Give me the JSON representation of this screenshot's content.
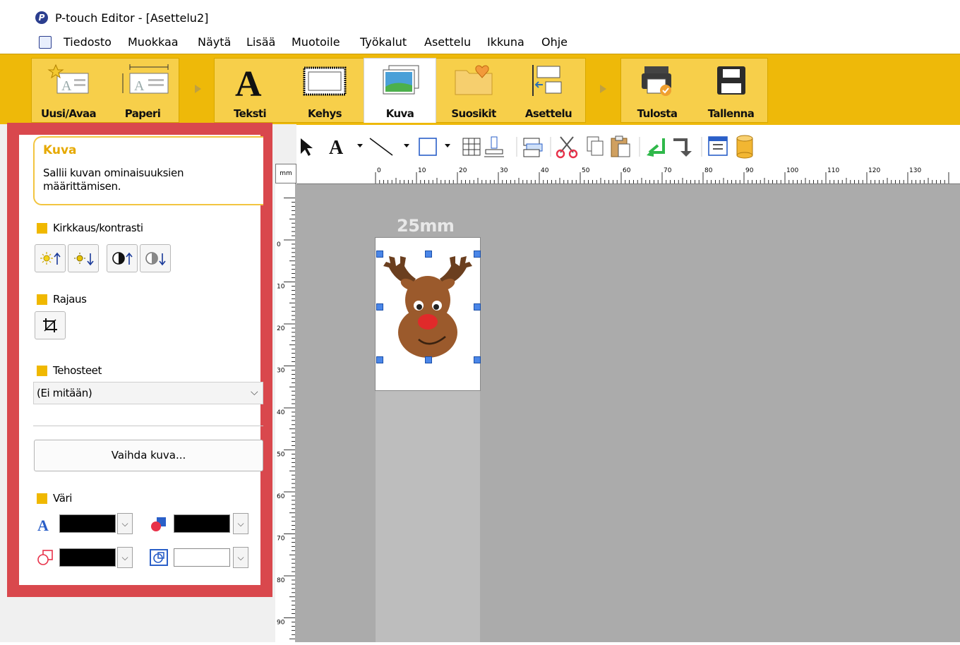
{
  "window": {
    "title": "P-touch Editor - [Asettelu2]",
    "icon": "p-touch-logo-icon"
  },
  "menu": [
    "Tiedosto",
    "Muokkaa",
    "Näytä",
    "Lisää",
    "Muotoile",
    "Työkalut",
    "Asettelu",
    "Ikkuna",
    "Ohje"
  ],
  "ribbon": {
    "buttons": [
      {
        "label": "Uusi/Avaa",
        "icon": "new-open-icon"
      },
      {
        "label": "Paperi",
        "icon": "paper-icon"
      },
      {
        "label": "Teksti",
        "icon": "text-icon"
      },
      {
        "label": "Kehys",
        "icon": "frame-icon"
      },
      {
        "label": "Kuva",
        "icon": "image-icon",
        "active": true
      },
      {
        "label": "Suosikit",
        "icon": "favorites-icon"
      },
      {
        "label": "Asettelu",
        "icon": "layout-icon"
      },
      {
        "label": "Tulosta",
        "icon": "print-icon"
      },
      {
        "label": "Tallenna",
        "icon": "save-icon"
      }
    ]
  },
  "panel": {
    "title": "Kuva",
    "description": "Sallii kuvan ominaisuuksien määrittämisen.",
    "brightness": {
      "label": "Kirkkaus/kontrasti",
      "buttons": [
        "brightness-up-icon",
        "brightness-down-icon",
        "contrast-up-icon",
        "contrast-down-icon"
      ]
    },
    "crop": {
      "label": "Rajaus",
      "button": "crop-icon"
    },
    "effects": {
      "label": "Tehosteet",
      "selected": "(Ei mitään)"
    },
    "change_image": "Vaihda kuva...",
    "color": {
      "label": "Väri",
      "text_color": "#000000",
      "fill_color": "#000000",
      "line_color": "#000000",
      "background_color": "#ffffff"
    }
  },
  "ruler": {
    "unit": "mm",
    "horizontal_ticks": [
      "0",
      "10",
      "20",
      "30",
      "40",
      "50",
      "60",
      "70",
      "80",
      "90",
      "100",
      "110",
      "120",
      "130"
    ],
    "vertical_ticks": [
      "0",
      "10",
      "20",
      "30",
      "40",
      "50",
      "60",
      "70",
      "80",
      "90"
    ]
  },
  "canvas": {
    "tape_width": "25mm",
    "image": "reindeer"
  },
  "colors": {
    "ribbon": "#eeb909",
    "accent": "#f0b800",
    "highlight_frame": "#d9484d",
    "canvas": "#ababab"
  }
}
